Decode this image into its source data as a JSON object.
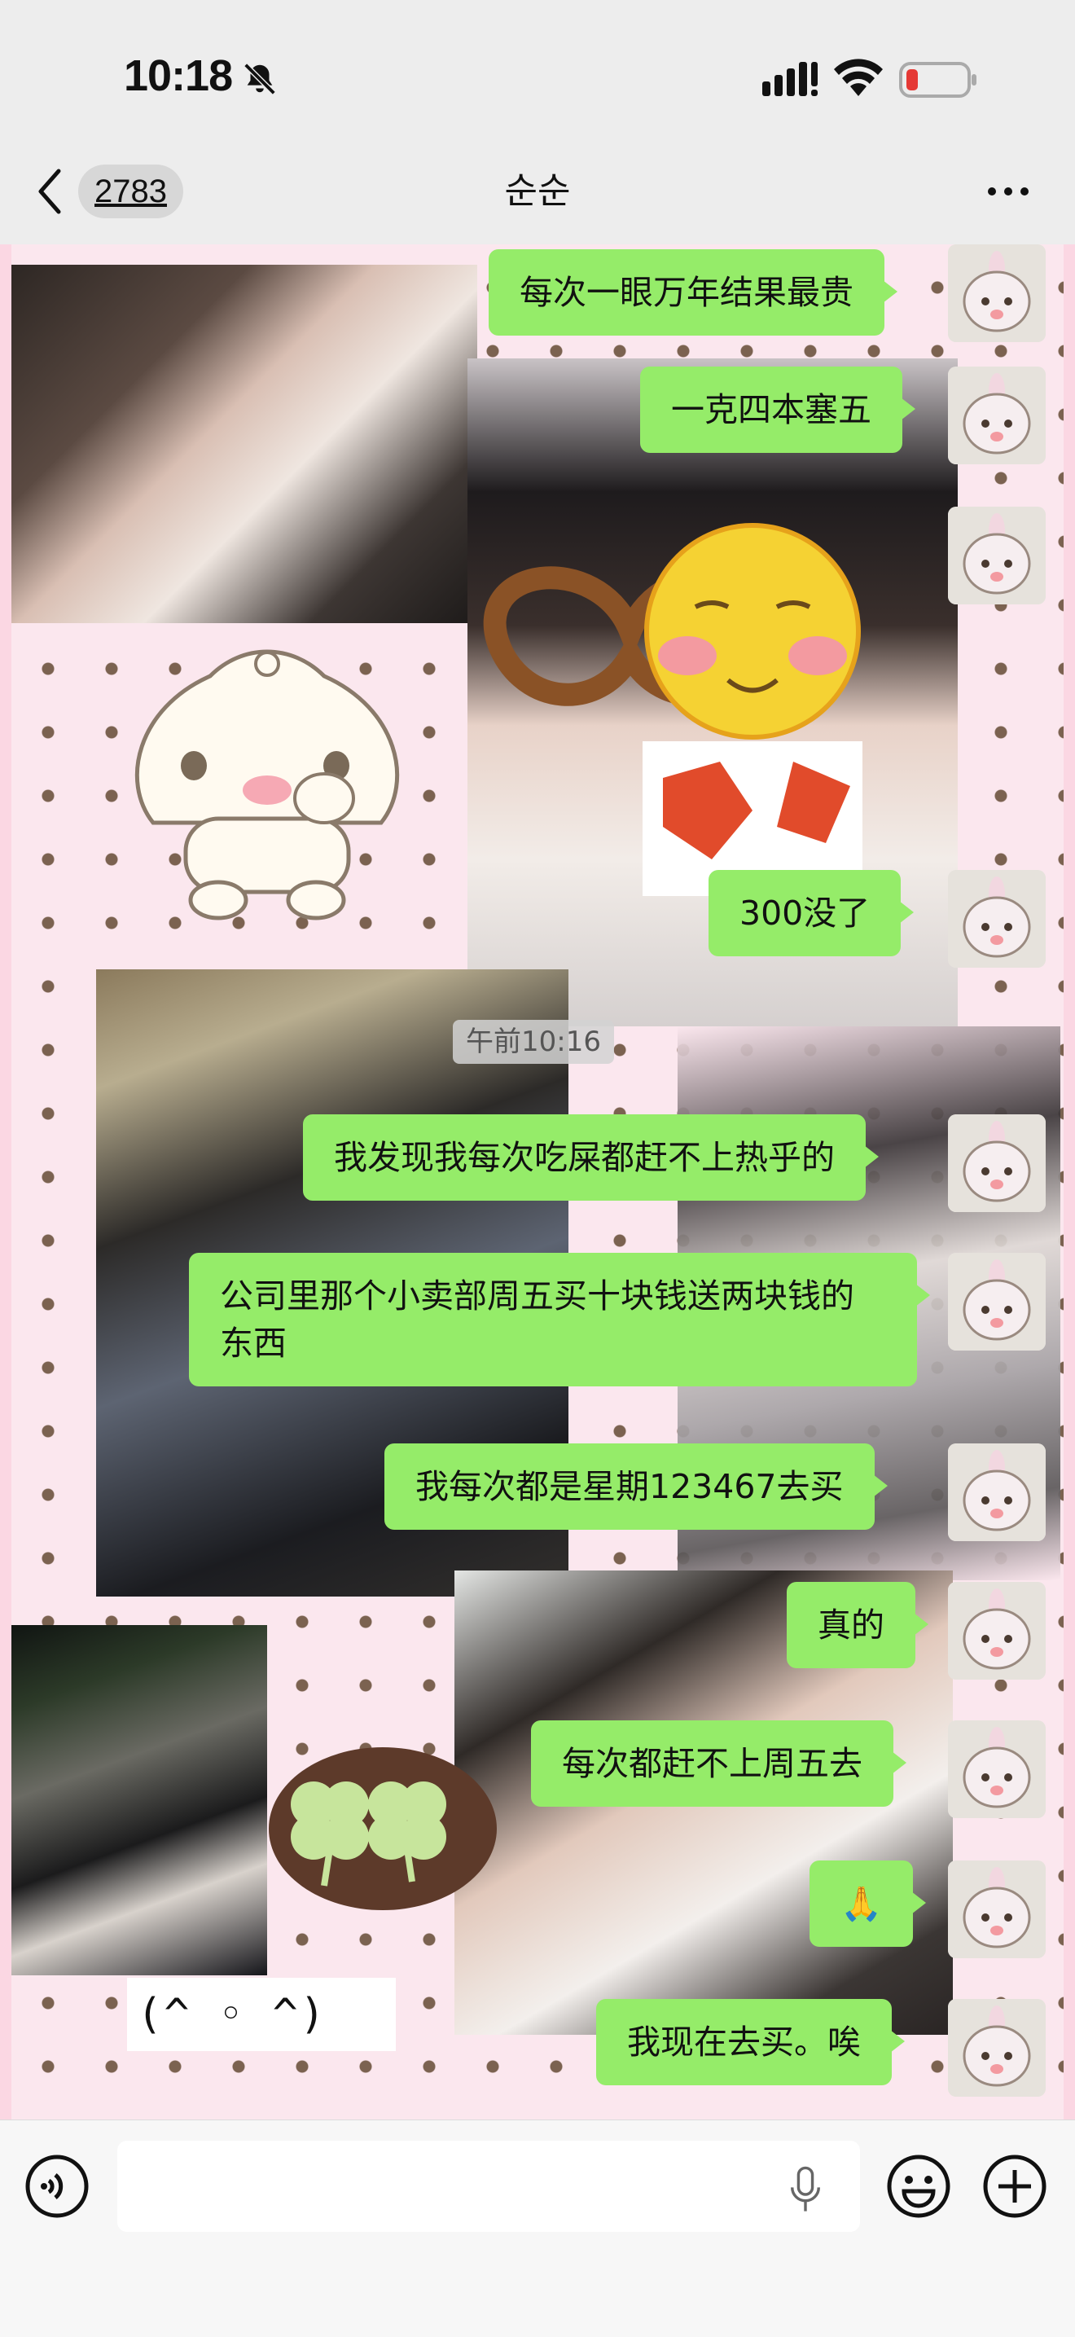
{
  "status_bar": {
    "time": "10:18"
  },
  "nav": {
    "unread_count": "2783",
    "title": "순순"
  },
  "timestamp": "午前10:16",
  "sticker_text": "(^ ◦ ^)",
  "messages": [
    "每次一眼万年结果最贵",
    "一克四本塞五",
    "300没了",
    "我发现我每次吃屎都赶不上热乎的",
    "公司里那个小卖部周五买十块钱送两块钱的东西",
    "我每次都是星期123467去买",
    "真的",
    "每次都赶不上周五去",
    "🙏",
    "我现在去买。唉"
  ],
  "colors": {
    "bubble": "#95ec69",
    "background": "#ededed",
    "wallpaper": "#fbe7ee"
  }
}
